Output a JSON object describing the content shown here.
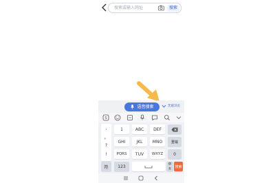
{
  "search": {
    "placeholder": "搜索或输入网址",
    "button_label": "搜索"
  },
  "keyboard_toolbar": {
    "voice_search_label": "语音搜索",
    "collapse_label": "无痕浏览"
  },
  "keyboard": {
    "punctuation": [
      ",",
      "。",
      "?",
      "!"
    ],
    "row1": [
      "1",
      "ABC",
      "DEF"
    ],
    "row2": [
      "GHI",
      "JKL",
      "MNO"
    ],
    "row3": [
      "PQRS",
      "TUV",
      "WXYZ"
    ],
    "right_column": [
      "重输",
      "0"
    ],
    "bottom": {
      "symbols": "符",
      "numbers": "123",
      "lang": "中",
      "lang_sub": "英",
      "search": "搜索"
    }
  },
  "colors": {
    "accent": "#4a76e0",
    "search_key": "#ef6a3a",
    "arrow": "#f6b94c"
  }
}
